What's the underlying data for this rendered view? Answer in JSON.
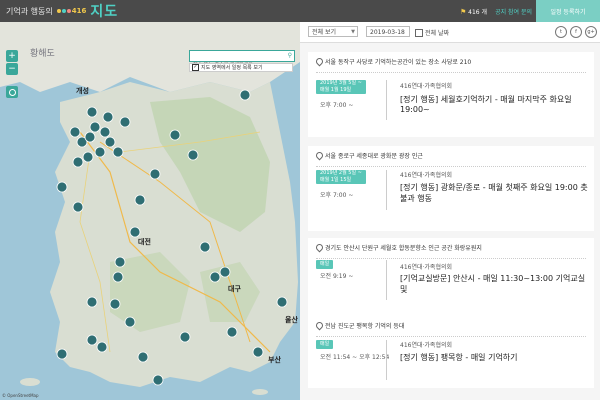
{
  "header": {
    "brand_text": "기억과 행동의",
    "brand_number": "416",
    "brand_title": "지도",
    "flag_icon": "flag-icon",
    "count_text": "416 개",
    "links_text": "공지 참여 문의",
    "action_button": "일정 등록하기"
  },
  "map": {
    "search_placeholder": "장소 또는 주소를 검색하세요",
    "checkbox_label": "지도 영역에서 일정 목록 보기",
    "zoom_in": "+",
    "zoom_out": "−",
    "cities": [
      "개성",
      "대전",
      "대구",
      "울산",
      "부산"
    ],
    "sea_label": "황해도",
    "copyright": "© OpenStreetMap"
  },
  "list": {
    "category_select": "전체 보기",
    "date_value": "2019-03-18",
    "all_dates_label": "전체 날짜",
    "share_icons": [
      "twitter-icon",
      "facebook-icon",
      "googleplus-icon"
    ],
    "share_glyphs": [
      "t",
      "f",
      "g+"
    ],
    "events": [
      {
        "location": "서울 동작구 사당로 기억하는공간이 있는 장소 사당로 210",
        "badge_line1": "2019년 3월 5일 ~",
        "badge_line2": "매월 1월 19일",
        "time": "오후 7:00 ~",
        "org": "416연대·가족협의회",
        "title": "[정기 행동] 세월호기억하기 - 매월 마지막주 화요일 19:00~"
      },
      {
        "location": "서울 종로구 세종대로 광화문 광장 인근",
        "badge_line1": "2019년 2월 5일 ~",
        "badge_line2": "매월 1일 15일",
        "time": "오후 7:00 ~",
        "org": "416연대·가족협의회",
        "title": "[정기 행동] 광화문/종로 - 매월 첫째주 화요일 19:00 촛불과 행동"
      },
      {
        "location": "경기도 안산시 단원구 세월호 합동분향소 인근 공간 화랑유원지",
        "badge_line1": "매일",
        "badge_line2": "",
        "time": "오전 9:19 ~",
        "org": "416연대·가족협의회",
        "title": "[기억교실방문] 안산시 - 매일 11:30~13:00 기억교실 및"
      },
      {
        "location": "전남 진도군 팽목항 기억의 등대",
        "badge_line1": "매일",
        "badge_line2": "",
        "time": "오전 11:54 ~ 오후 12:54",
        "org": "416연대·가족협의회",
        "title": "[정기 행동] 팽목항 - 매일 기억하기"
      }
    ]
  }
}
